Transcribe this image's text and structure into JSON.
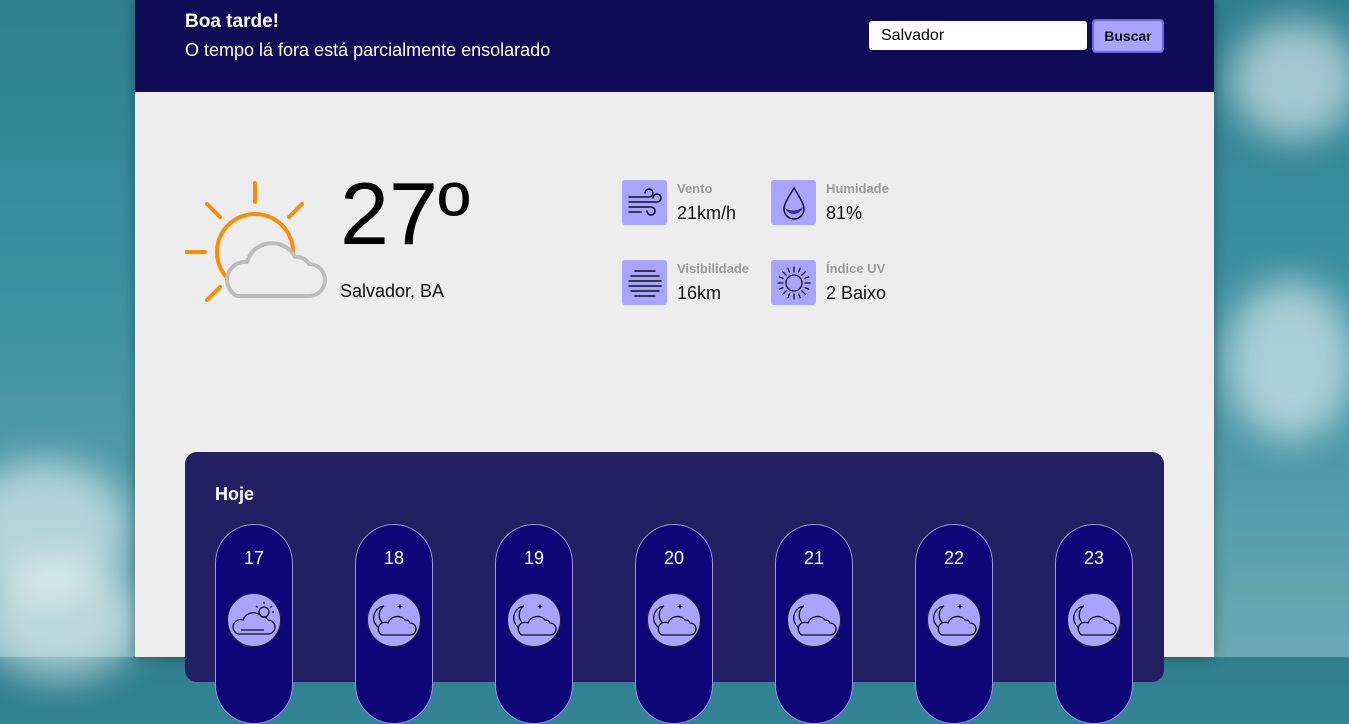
{
  "header": {
    "greeting": "Boa tarde!",
    "subtitle": "O tempo lá fora está parcialmente ensolarado",
    "search_value": "Salvador",
    "search_button": "Buscar"
  },
  "current": {
    "temperature": "27º",
    "city": "Salvador, BA",
    "icon": "partly-sunny-icon"
  },
  "stats": [
    {
      "label": "Vento",
      "value": "21km/h",
      "icon": "wind-icon"
    },
    {
      "label": "Humidade",
      "value": "81%",
      "icon": "water-drop-icon"
    },
    {
      "label": "Visibilidade",
      "value": "16km",
      "icon": "fog-icon"
    },
    {
      "label": "Índice UV",
      "value": "2 Baixo",
      "icon": "sun-icon"
    }
  ],
  "today": {
    "title": "Hoje",
    "hours": [
      {
        "hour": "17",
        "icon": "partly-cloudy-day-icon"
      },
      {
        "hour": "18",
        "icon": "partly-cloudy-night-icon"
      },
      {
        "hour": "19",
        "icon": "partly-cloudy-night-icon"
      },
      {
        "hour": "20",
        "icon": "partly-cloudy-night-icon"
      },
      {
        "hour": "21",
        "icon": "cloudy-night-icon"
      },
      {
        "hour": "22",
        "icon": "partly-cloudy-night-icon"
      },
      {
        "hour": "23",
        "icon": "cloudy-night-icon"
      }
    ]
  },
  "colors": {
    "header_bg": "#100b55",
    "accent": "#a8a4ff",
    "card_bg": "#231f63",
    "pill_bg": "#0e0678",
    "sun": "#ff8c00"
  }
}
